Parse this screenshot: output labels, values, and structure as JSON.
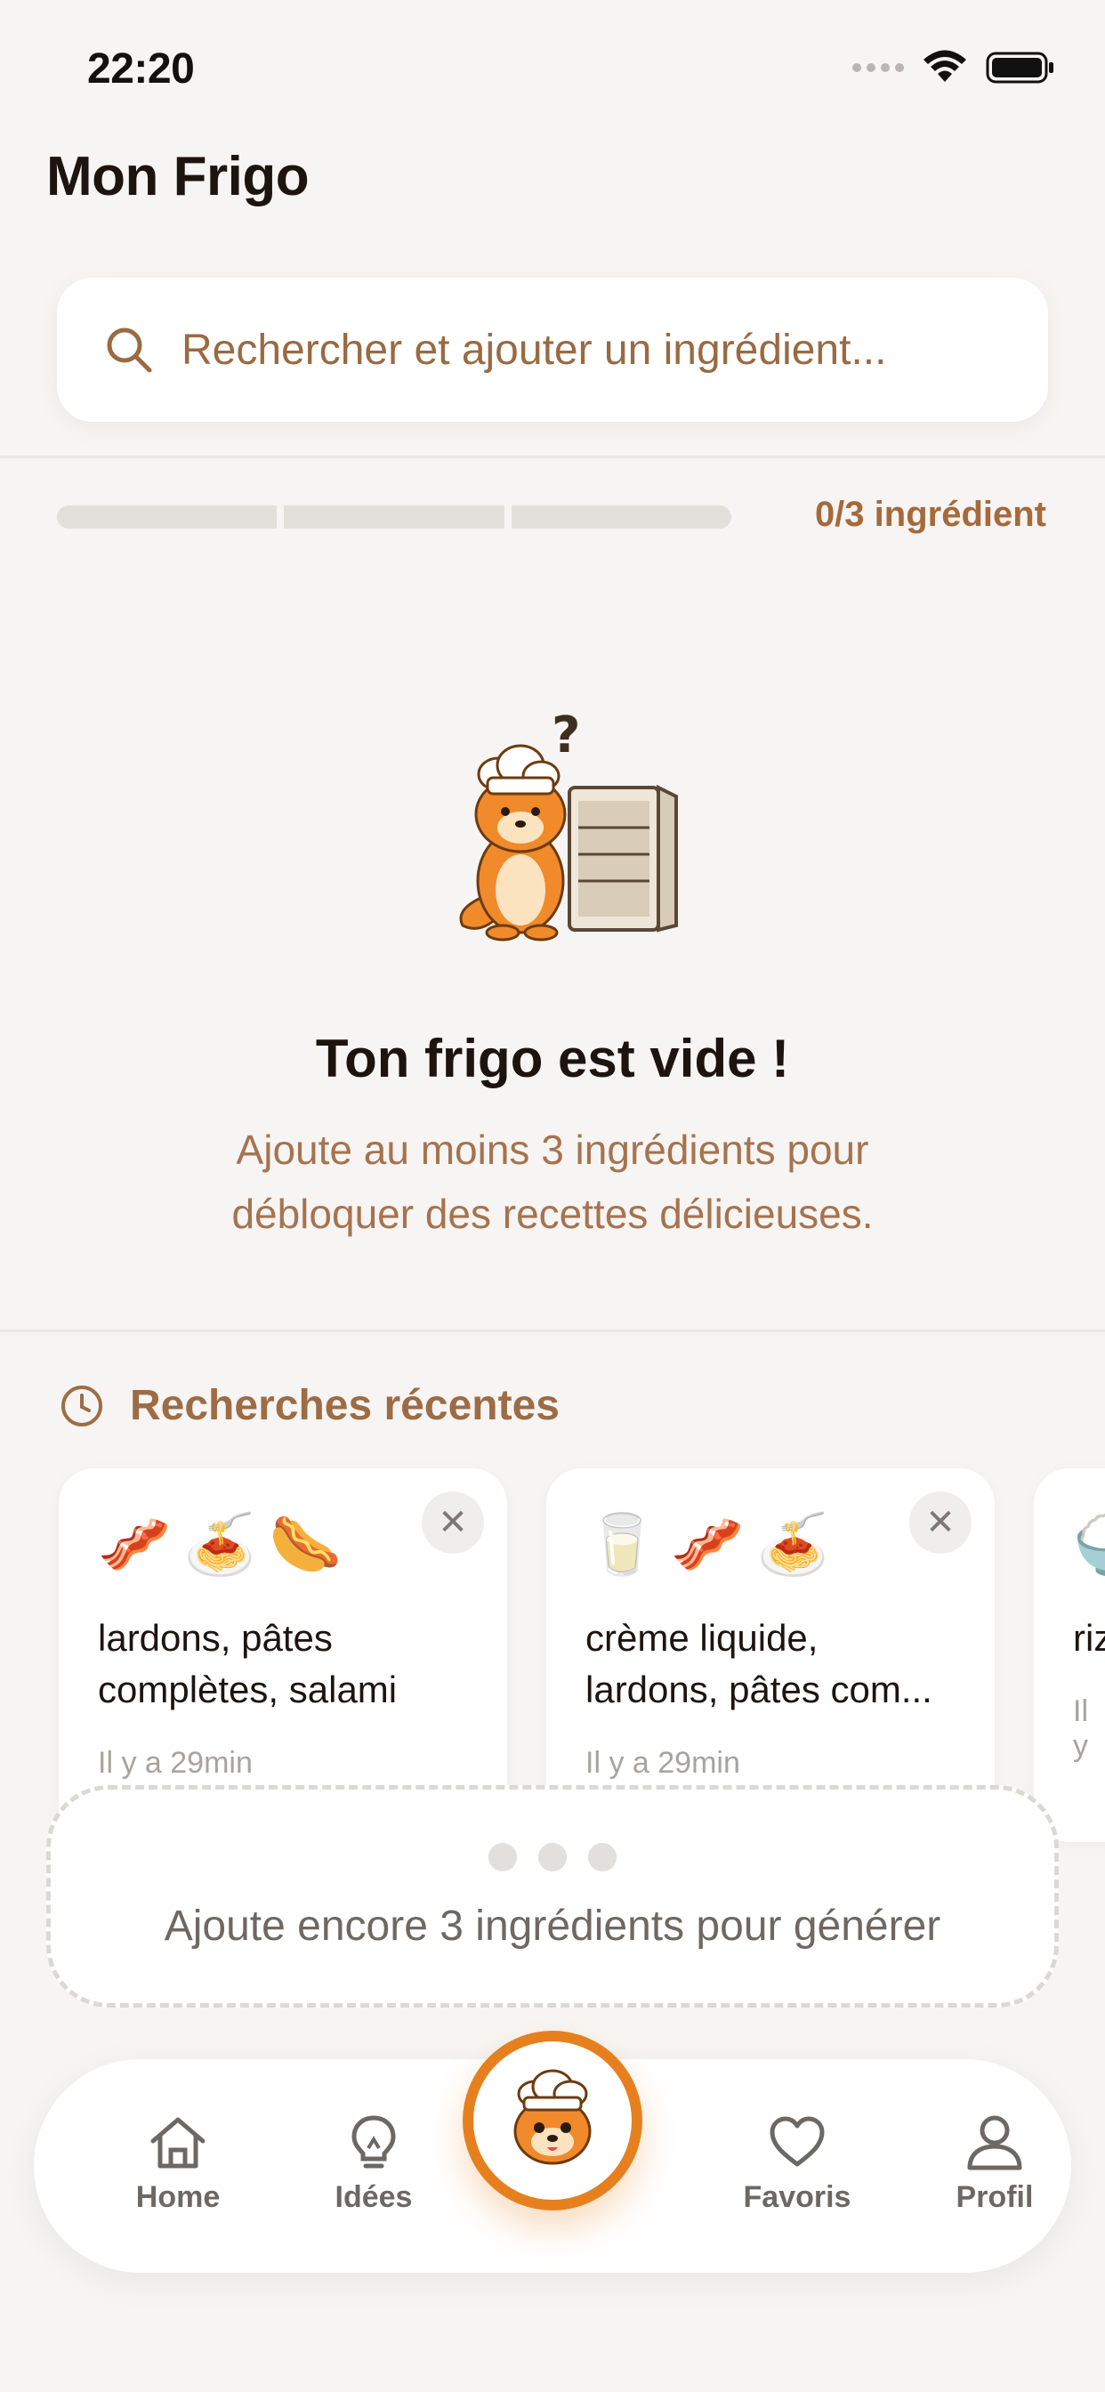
{
  "status": {
    "time": "22:20"
  },
  "header": {
    "title": "Mon Frigo"
  },
  "search": {
    "placeholder": "Rechercher et ajouter un ingrédient..."
  },
  "progress": {
    "label": "0/3 ingrédient",
    "current": 0,
    "total": 3
  },
  "empty_state": {
    "title": "Ton frigo est vide !",
    "description": "Ajoute au moins 3 ingrédients pour débloquer des recettes délicieuses."
  },
  "recent": {
    "title": "Recherches récentes",
    "items": [
      {
        "emojis": "🥓🍝🌭",
        "names": "lardons, pâtes complètes, salami",
        "time": "Il y a 29min"
      },
      {
        "emojis": "🥛🥓🍝",
        "names": "crème liquide, lardons, pâtes com...",
        "time": "Il y a 29min"
      },
      {
        "emojis": "🍚",
        "names": "riz lic",
        "time": "Il y"
      }
    ]
  },
  "generate": {
    "message": "Ajoute encore 3 ingrédients pour générer"
  },
  "nav": {
    "items": [
      {
        "label": "Home",
        "icon": "home-icon"
      },
      {
        "label": "Idées",
        "icon": "lightbulb-icon"
      },
      {
        "label": "Favoris",
        "icon": "heart-icon"
      },
      {
        "label": "Profil",
        "icon": "user-icon"
      }
    ]
  },
  "colors": {
    "accent": "#e6801f",
    "brown_text": "#a6693a",
    "background": "#f7f5f3"
  }
}
